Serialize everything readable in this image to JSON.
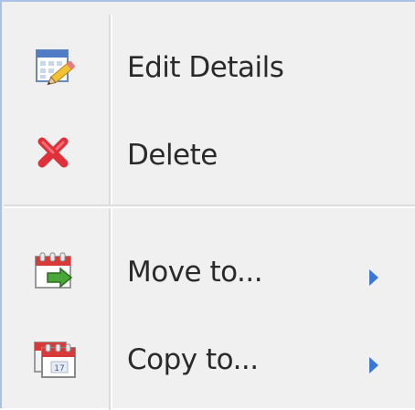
{
  "menu": {
    "items": [
      {
        "label": "Edit Details",
        "icon": "edit-calendar-icon",
        "has_submenu": false
      },
      {
        "label": "Delete",
        "icon": "delete-x-icon",
        "has_submenu": false
      },
      {
        "label": "Move to...",
        "icon": "calendar-move-icon",
        "has_submenu": true
      },
      {
        "label": "Copy to...",
        "icon": "calendar-copy-icon",
        "has_submenu": true
      }
    ],
    "colors": {
      "background": "#f0f0f0",
      "border": "#a9c1e4",
      "text": "#2a2a2a",
      "submenu_arrow": "#3a78d6",
      "delete_icon": "#e0303a"
    }
  }
}
